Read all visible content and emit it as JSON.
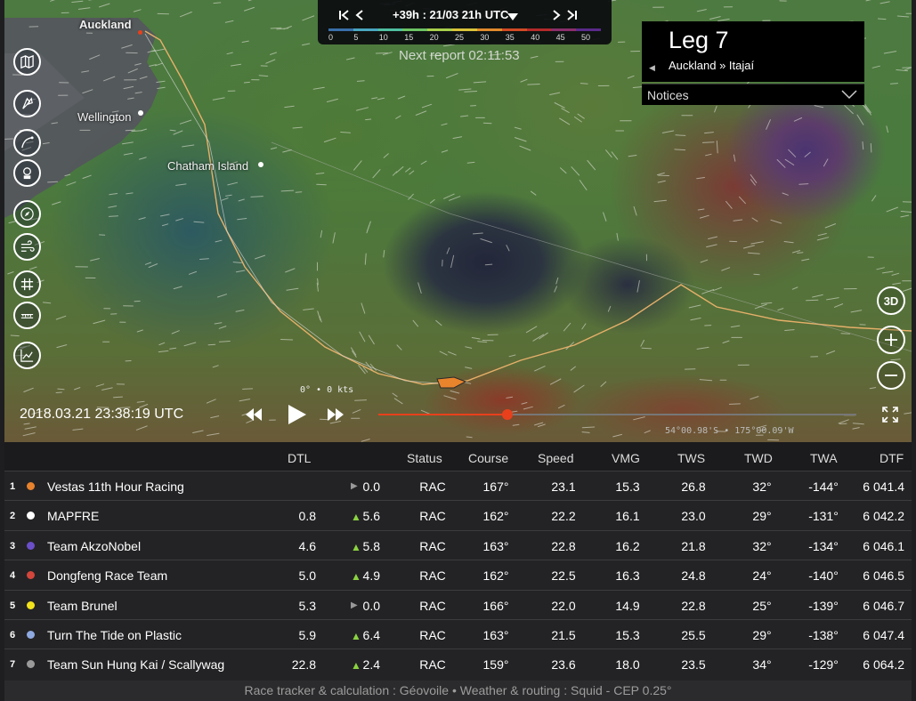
{
  "map": {
    "cities": [
      {
        "name": "Auckland",
        "bold": true
      },
      {
        "name": "Wellington",
        "bold": false
      },
      {
        "name": "Chatham Island",
        "bold": false
      }
    ],
    "next_report": "Next report 02:11:53",
    "wind_readout": "0° • 0 kts",
    "cursor_coord": "54°00.98'S • 175°00.09'W"
  },
  "toolbar": {
    "items": [
      {
        "icon": "map-book-icon"
      },
      {
        "icon": "boat-icon"
      },
      {
        "icon": "route-icon"
      },
      {
        "icon": "tracker-icon"
      },
      {
        "icon": "compass-icon"
      },
      {
        "icon": "wind-icon"
      },
      {
        "icon": "grid-icon"
      },
      {
        "icon": "ruler-icon"
      },
      {
        "icon": "chart-icon"
      }
    ]
  },
  "timebar": {
    "label": "+39h : 21/03 21h UTC",
    "scale": {
      "labels": [
        "0",
        "5",
        "10",
        "15",
        "20",
        "25",
        "30",
        "35",
        "40",
        "45",
        "50"
      ],
      "colors": [
        "#3a6ea8",
        "#4aa6c0",
        "#4fbfa0",
        "#6cc464",
        "#a9cf4c",
        "#d9c43a",
        "#e08a2c",
        "#d24a24",
        "#b42a2a",
        "#8a2e6a",
        "#5a2a8a"
      ]
    }
  },
  "leg": {
    "title": "Leg 7",
    "route": "Auckland » Itajaí",
    "notices_label": "Notices"
  },
  "controls": {
    "three_d": "3D"
  },
  "playback": {
    "date": "2018.03.21 23:38:19 UTC",
    "progress": 0.27
  },
  "table": {
    "headers": {
      "dtl": "DTL",
      "status": "Status",
      "course": "Course",
      "speed": "Speed",
      "vmg": "VMG",
      "tws": "TWS",
      "twd": "TWD",
      "twa": "TWA",
      "dtf": "DTF"
    },
    "rows": [
      {
        "rank": "1",
        "color": "#e8822c",
        "name": "Vestas 11th Hour Racing",
        "dtl": "",
        "trend": "flat",
        "delta": "0.0",
        "status": "RAC",
        "course": "167°",
        "speed": "23.1",
        "vmg": "15.3",
        "tws": "26.8",
        "twd": "32°",
        "twa": "-144°",
        "dtf": "6 041.4"
      },
      {
        "rank": "2",
        "color": "#ffffff",
        "name": "MAPFRE",
        "dtl": "0.8",
        "trend": "up",
        "delta": "5.6",
        "status": "RAC",
        "course": "162°",
        "speed": "22.2",
        "vmg": "16.1",
        "tws": "23.0",
        "twd": "29°",
        "twa": "-131°",
        "dtf": "6 042.2"
      },
      {
        "rank": "3",
        "color": "#6a4fc8",
        "name": "Team AkzoNobel",
        "dtl": "4.6",
        "trend": "up",
        "delta": "5.8",
        "status": "RAC",
        "course": "163°",
        "speed": "22.8",
        "vmg": "16.2",
        "tws": "21.8",
        "twd": "32°",
        "twa": "-134°",
        "dtf": "6 046.1"
      },
      {
        "rank": "4",
        "color": "#d2463c",
        "name": "Dongfeng Race Team",
        "dtl": "5.0",
        "trend": "up",
        "delta": "4.9",
        "status": "RAC",
        "course": "162°",
        "speed": "22.5",
        "vmg": "16.3",
        "tws": "24.8",
        "twd": "24°",
        "twa": "-140°",
        "dtf": "6 046.5"
      },
      {
        "rank": "5",
        "color": "#f2e21c",
        "name": "Team Brunel",
        "dtl": "5.3",
        "trend": "flat",
        "delta": "0.0",
        "status": "RAC",
        "course": "166°",
        "speed": "22.0",
        "vmg": "14.9",
        "tws": "22.8",
        "twd": "25°",
        "twa": "-139°",
        "dtf": "6 046.7"
      },
      {
        "rank": "6",
        "color": "#8ea8e0",
        "name": "Turn The Tide on Plastic",
        "dtl": "5.9",
        "trend": "up",
        "delta": "6.4",
        "status": "RAC",
        "course": "163°",
        "speed": "21.5",
        "vmg": "15.3",
        "tws": "25.5",
        "twd": "29°",
        "twa": "-138°",
        "dtf": "6 047.4"
      },
      {
        "rank": "7",
        "color": "#9a9a9a",
        "name": "Team Sun Hung Kai / Scallywag",
        "dtl": "22.8",
        "trend": "up",
        "delta": "2.4",
        "status": "RAC",
        "course": "159°",
        "speed": "23.6",
        "vmg": "18.0",
        "tws": "23.5",
        "twd": "34°",
        "twa": "-129°",
        "dtf": "6 064.2"
      }
    ]
  },
  "footer": {
    "text": "Race tracker & calculation : Géovoile • Weather & routing : Squid - CEP 0.25°"
  }
}
